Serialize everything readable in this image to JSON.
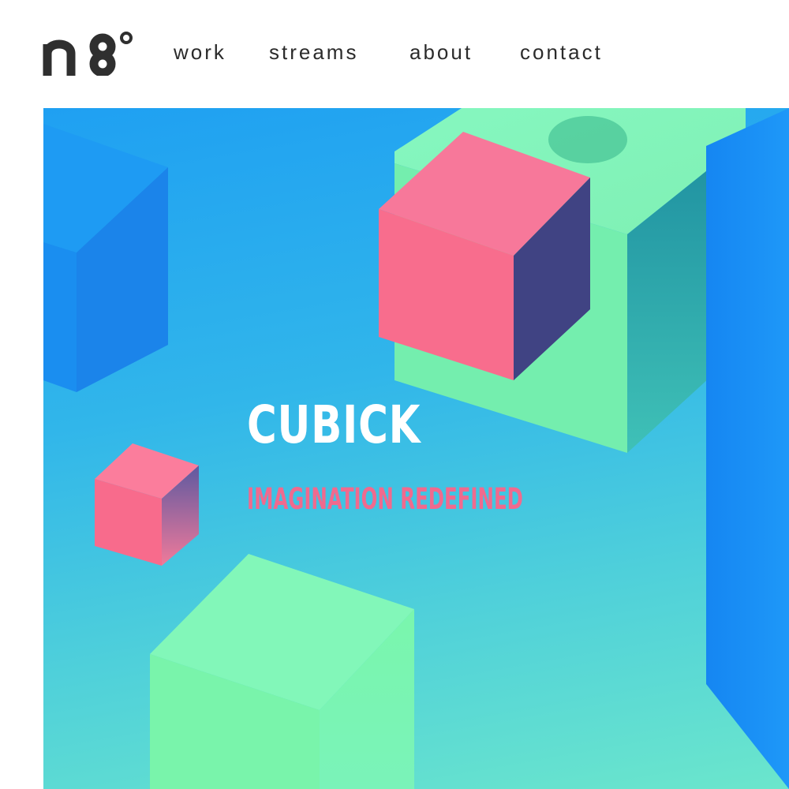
{
  "brand": {
    "logo_text": "n8°"
  },
  "nav": {
    "items": [
      {
        "label": "work"
      },
      {
        "label": "streams"
      },
      {
        "label": "about"
      },
      {
        "label": "contact"
      }
    ]
  },
  "hero": {
    "title": "CUBICK",
    "subtitle": "IMAGINATION REDEFINED"
  },
  "colors": {
    "text_dark": "#2b2b2b",
    "accent_pink": "#f06a8e",
    "cube_pink": "#f9718f",
    "cube_green": "#74f0a8",
    "cube_blue": "#1a82f0"
  }
}
